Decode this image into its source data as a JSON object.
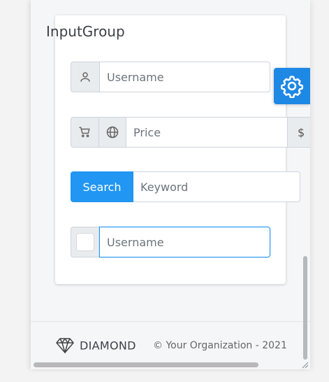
{
  "card": {
    "title": "InputGroup"
  },
  "groups": {
    "username": {
      "placeholder": "Username",
      "icon": "user-icon"
    },
    "price": {
      "placeholder": "Price",
      "prefix_icons": [
        "cart-icon",
        "globe-icon"
      ],
      "suffix": "$"
    },
    "search": {
      "button_label": "Search",
      "placeholder": "Keyword"
    },
    "checkbox_username": {
      "placeholder": "Username",
      "checked": false
    }
  },
  "settings": {
    "icon": "gear-icon"
  },
  "footer": {
    "brand": "DIAMOND",
    "logo_icon": "diamond-icon",
    "copyright": "© Your Organization - 2021"
  },
  "colors": {
    "primary": "#2196f3",
    "settings_bg": "#1e88e5"
  }
}
